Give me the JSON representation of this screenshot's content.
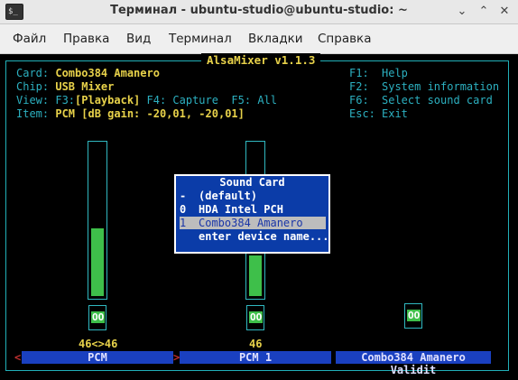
{
  "window": {
    "title": "Терминал - ubuntu-studio@ubuntu-studio: ~",
    "app_icon": "terminal-icon",
    "minimize_glyph": "⌄",
    "maximize_glyph": "⌃",
    "close_glyph": "✕"
  },
  "menu": [
    "Файл",
    "Правка",
    "Вид",
    "Терминал",
    "Вкладки",
    "Справка"
  ],
  "alsa": {
    "title": "AlsaMixer v1.1.3",
    "card_label": "Card: ",
    "card_value": "Combo384 Amanero",
    "chip_label": "Chip: ",
    "chip_value": "USB Mixer",
    "view_label": "View: F3:",
    "view_active": "[Playback]",
    "view_rest": " F4: Capture  F5: All",
    "item_label": "Item: ",
    "item_value": "PCM [dB gain: -20,01, -20,01]",
    "keys": [
      {
        "key": "F1:",
        "desc": "Help"
      },
      {
        "key": "F2:",
        "desc": "System information"
      },
      {
        "key": "F6:",
        "desc": "Select sound card"
      },
      {
        "key": "Esc:",
        "desc": "Exit"
      }
    ]
  },
  "channels": [
    {
      "name": "PCM",
      "volume": "46<>46",
      "mute": "OO",
      "level_percent": 46
    },
    {
      "name": "PCM 1",
      "volume": "46",
      "mute": "OO",
      "level_percent": 46
    },
    {
      "name": "Combo384 Amanero Validit",
      "volume": "",
      "mute": "OO"
    }
  ],
  "arrows": {
    "left": "<",
    "right": ">"
  },
  "dialog": {
    "title": "Sound Card",
    "items": [
      {
        "key": "-",
        "label": "(default)"
      },
      {
        "key": "0",
        "label": "HDA Intel PCH"
      },
      {
        "key": "1",
        "label": "Combo384 Amanero",
        "selected": true
      },
      {
        "key": "",
        "label": "enter device name..."
      }
    ]
  }
}
